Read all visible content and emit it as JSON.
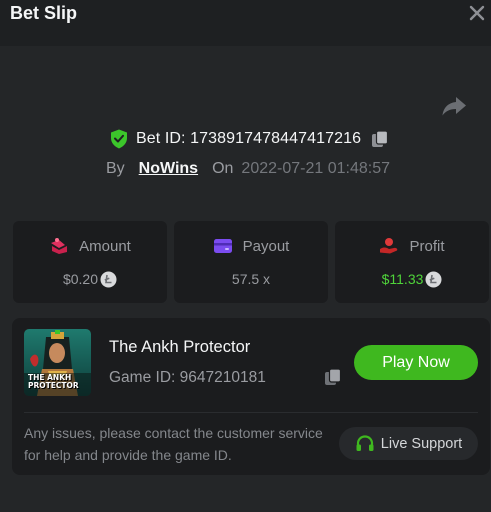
{
  "header": {
    "title": "Bet Slip",
    "close_icon": "close-icon"
  },
  "bet": {
    "share_icon": "share-icon",
    "verified_icon": "shield-check-icon",
    "bet_id_text": "Bet ID: 1738917478447417216",
    "copy_icon": "copy-icon",
    "by_label": "By",
    "username": "NoWins",
    "on_label": "On",
    "datetime": "2022-07-21 01:48:57"
  },
  "stats": {
    "amount": {
      "label": "Amount",
      "value": "$0.20",
      "icon": "wallet-icon",
      "currency_icon": "litecoin-icon"
    },
    "payout": {
      "label": "Payout",
      "value": "57.5 x",
      "icon": "card-icon"
    },
    "profit": {
      "label": "Profit",
      "value": "$11.33",
      "icon": "hand-coin-icon",
      "currency_icon": "litecoin-icon"
    }
  },
  "game": {
    "thumbnail_text": "THE ANKH PROTECTOR",
    "name": "The Ankh Protector",
    "game_id_text": "Game ID: 9647210181",
    "copy_icon": "copy-icon",
    "play_label": "Play Now",
    "help_text": "Any issues, please contact the customer service for help and provide the game ID.",
    "support_label": "Live Support",
    "support_icon": "headset-icon"
  },
  "colors": {
    "background": "#1e2022",
    "panel": "#242628",
    "card": "#1b1c1e",
    "accent_green": "#3fb81f",
    "profit_green": "#4fd33a",
    "shield_green": "#3cc62b",
    "amount_icon": "#e0315f",
    "payout_icon": "#7b4cf0",
    "profit_icon": "#e03a3a"
  }
}
